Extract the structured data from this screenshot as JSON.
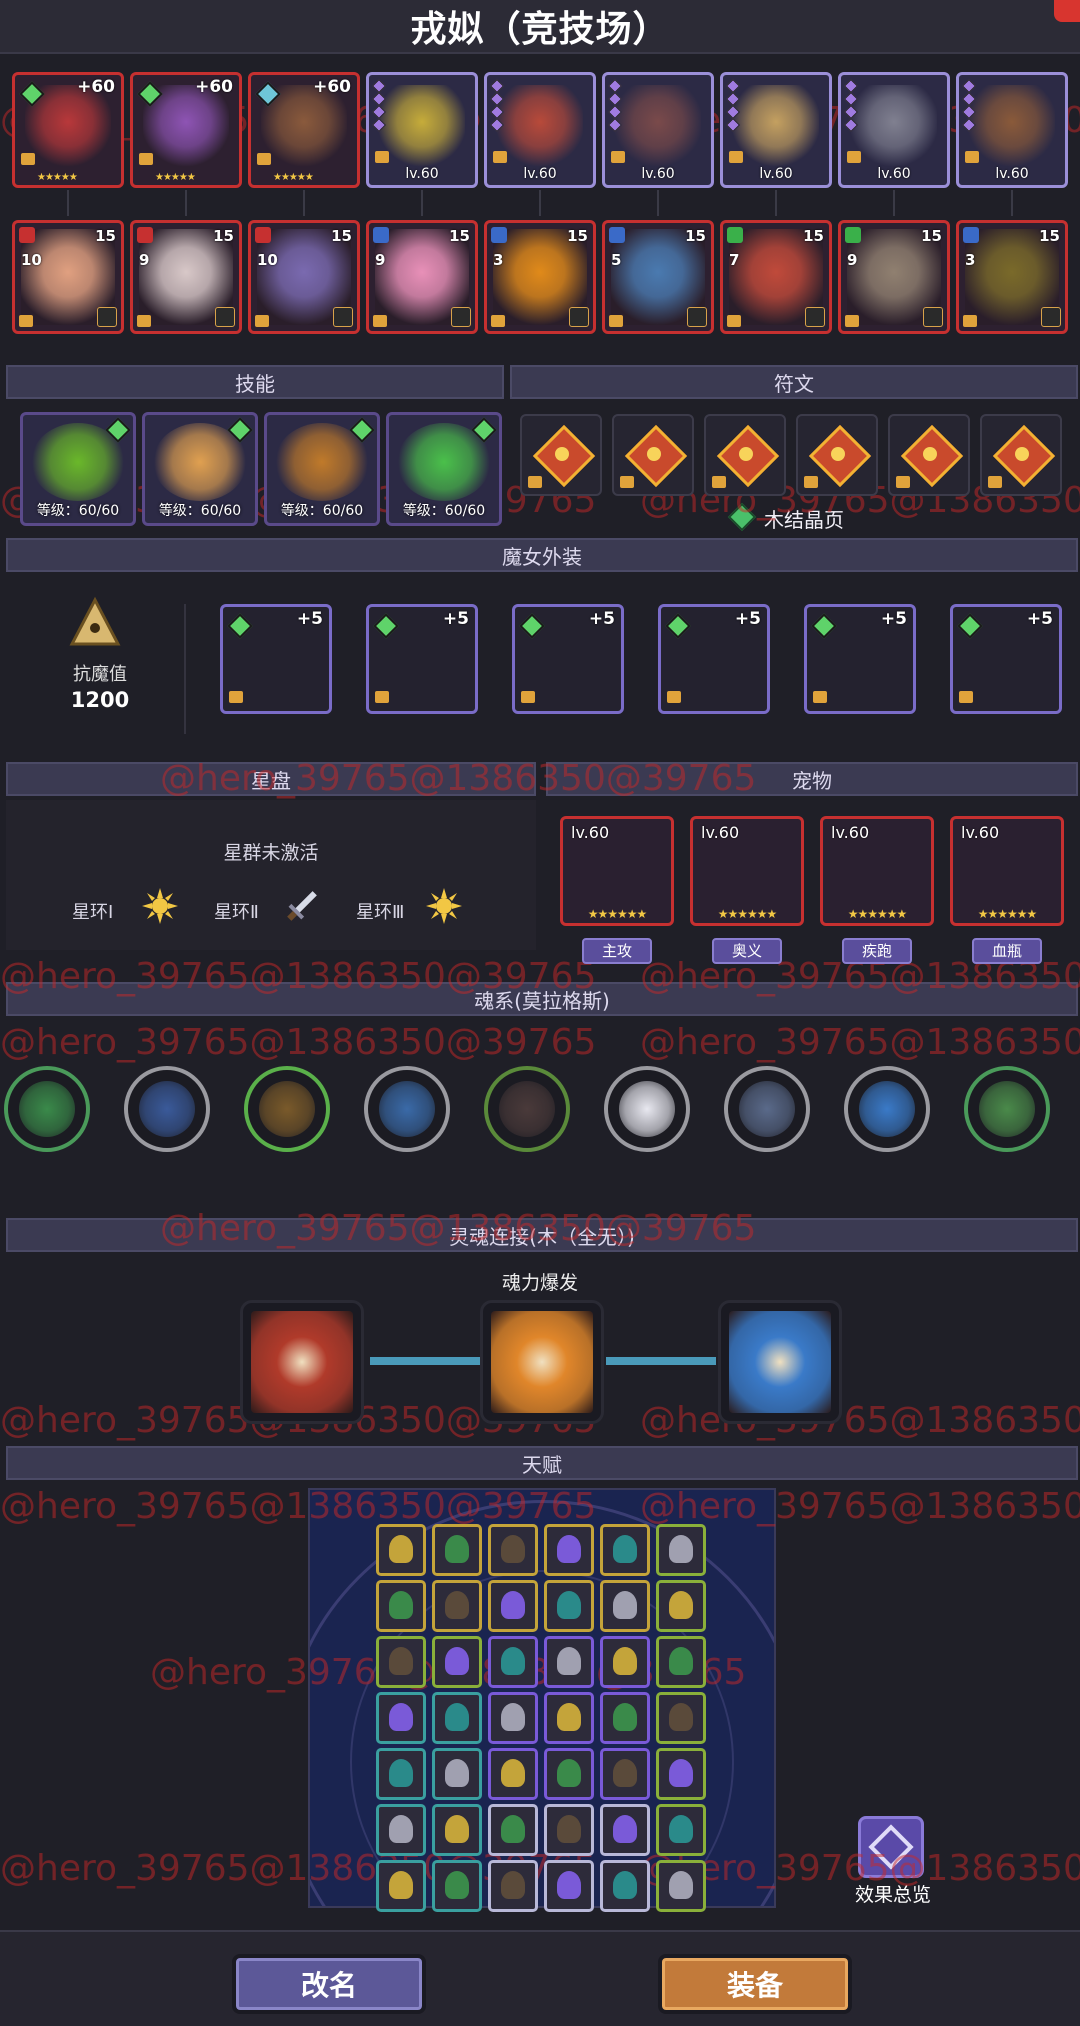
{
  "title": "戎姒（竞技场）",
  "equipment": [
    {
      "label": "+60",
      "frame": "red",
      "gem": "#5fd36a",
      "color": "#b8383a"
    },
    {
      "label": "+60",
      "frame": "red",
      "gem": "#5fd36a",
      "color": "#8e54b4"
    },
    {
      "label": "+60",
      "frame": "red",
      "gem": "#6ec6d8",
      "color": "#8a5a3c"
    },
    {
      "label": "lv.60",
      "frame": "purple",
      "color": "#c6ac3a"
    },
    {
      "label": "lv.60",
      "frame": "purple",
      "color": "#b84a3a"
    },
    {
      "label": "lv.60",
      "frame": "purple",
      "color": "#7a4a4a"
    },
    {
      "label": "lv.60",
      "frame": "purple",
      "color": "#c4a060"
    },
    {
      "label": "lv.60",
      "frame": "purple",
      "color": "#808090"
    },
    {
      "label": "lv.60",
      "frame": "purple",
      "color": "#8a5a3a"
    }
  ],
  "heroes": [
    {
      "num": "10",
      "stars": "15",
      "cls": "#c63030",
      "color": "#e0a080"
    },
    {
      "num": "9",
      "stars": "15",
      "cls": "#c63030",
      "color": "#d8c8c8"
    },
    {
      "num": "10",
      "stars": "15",
      "cls": "#c63030",
      "color": "#7a6ab0"
    },
    {
      "num": "9",
      "stars": "15",
      "cls": "#3a6ac8",
      "color": "#e890b8"
    },
    {
      "num": "3",
      "stars": "15",
      "cls": "#3a6ac8",
      "color": "#e08a1a"
    },
    {
      "num": "5",
      "stars": "15",
      "cls": "#3a6ac8",
      "color": "#4a7ab0"
    },
    {
      "num": "7",
      "stars": "15",
      "cls": "#3ab04a",
      "color": "#c04a3a"
    },
    {
      "num": "9",
      "stars": "15",
      "cls": "#3ab04a",
      "color": "#908070"
    },
    {
      "num": "3",
      "stars": "15",
      "cls": "#3a6ac8",
      "color": "#7a6a2a"
    }
  ],
  "sections": {
    "skills": "技能",
    "runes": "符文",
    "costume": "魔女外装",
    "starchart": "星盘",
    "pets": "宠物",
    "soul": "魂系(莫拉格斯)",
    "link": "灵魂连接(木（全无）)",
    "talent": "天赋"
  },
  "skills": [
    {
      "level": "等级：60/60",
      "color": "#6ab82a"
    },
    {
      "level": "等级：60/60",
      "color": "#e0a050"
    },
    {
      "level": "等级：60/60",
      "color": "#c07a2a"
    },
    {
      "level": "等级：60/60",
      "color": "#4ac04a"
    }
  ],
  "runes": {
    "count": 6,
    "set_name": "木结晶页"
  },
  "costume": {
    "resist_label": "抗魔值",
    "resist_value": "1200",
    "items": [
      {
        "plus": "+5",
        "color": "#b040c0"
      },
      {
        "plus": "+5",
        "color": "#9a4ac8"
      },
      {
        "plus": "+5",
        "color": "#c050d8"
      },
      {
        "plus": "+5",
        "color": "#8a9ac8"
      },
      {
        "plus": "+5",
        "color": "#9040b0"
      },
      {
        "plus": "+5",
        "color": "#c070c8"
      }
    ]
  },
  "starchart": {
    "status": "星群未激活",
    "rings": [
      {
        "label": "星环Ⅰ"
      },
      {
        "label": "星环Ⅱ"
      },
      {
        "label": "星环Ⅲ"
      }
    ]
  },
  "pets": [
    {
      "lv": "lv.60",
      "name": "主攻",
      "color": "#6a6a8a"
    },
    {
      "lv": "lv.60",
      "name": "奥义",
      "color": "#e8b050"
    },
    {
      "lv": "lv.60",
      "name": "疾跑",
      "color": "#7ac8e8"
    },
    {
      "lv": "lv.60",
      "name": "血瓶",
      "color": "#4a6aa8"
    }
  ],
  "soul": [
    {
      "ring": "#4a9a5a",
      "fill": "#3a8a4a"
    },
    {
      "ring": "#9a9aa0",
      "fill": "#3a5a9a"
    },
    {
      "ring": "#5ab04a",
      "fill": "#7a5a2a"
    },
    {
      "ring": "#9a9aa0",
      "fill": "#3a6aa8"
    },
    {
      "ring": "#5a8a3a",
      "fill": "#4a3a3a"
    },
    {
      "ring": "#9a9aa0",
      "fill": "#e8e8f0"
    },
    {
      "ring": "#9a9aa0",
      "fill": "#5a6a8a"
    },
    {
      "ring": "#9a9aa0",
      "fill": "#3a7ac8"
    },
    {
      "ring": "#4a9a5a",
      "fill": "#4a8a4a"
    }
  ],
  "link": {
    "center_label": "魂力爆发",
    "nodes": [
      {
        "color": "#b03a2a"
      },
      {
        "color": "#e0862a"
      },
      {
        "color": "#3a7ac8"
      }
    ]
  },
  "talent": {
    "overview": "效果总览"
  },
  "buttons": {
    "rename": "改名",
    "equip": "装备"
  },
  "watermark": "@hero_39765@1386350@39765"
}
